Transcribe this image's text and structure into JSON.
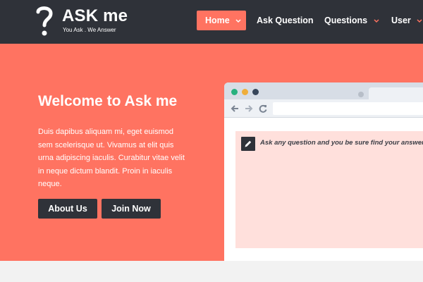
{
  "brand": {
    "title": "ASK me",
    "tagline": "You Ask . We Answer",
    "logo_icon": "question-mark-icon"
  },
  "nav": {
    "items": [
      {
        "label": "Home",
        "active": true,
        "has_dropdown": true
      },
      {
        "label": "Ask Question",
        "active": false,
        "has_dropdown": false
      },
      {
        "label": "Questions",
        "active": false,
        "has_dropdown": true
      },
      {
        "label": "User",
        "active": false,
        "has_dropdown": true
      }
    ]
  },
  "hero": {
    "title": "Welcome to Ask me",
    "text": "Duis dapibus aliquam mi, eget euismod sem scelerisque ut. Vivamus at elit quis urna adipiscing iaculis. Curabitur vitae velit in neque dictum blandit. Proin in iaculis neque.",
    "buttons": {
      "about": "About Us",
      "join": "Join Now"
    }
  },
  "browser": {
    "ask_placeholder": "Ask any question and you be sure find your answer",
    "icons": [
      "back-arrow-icon",
      "forward-arrow-icon",
      "reload-icon",
      "pencil-icon"
    ]
  },
  "colors": {
    "header_bg": "#2f3239",
    "accent": "#ff7361",
    "ask_panel_bg": "#ffe0dc",
    "page_bg": "#f2f2f2"
  }
}
